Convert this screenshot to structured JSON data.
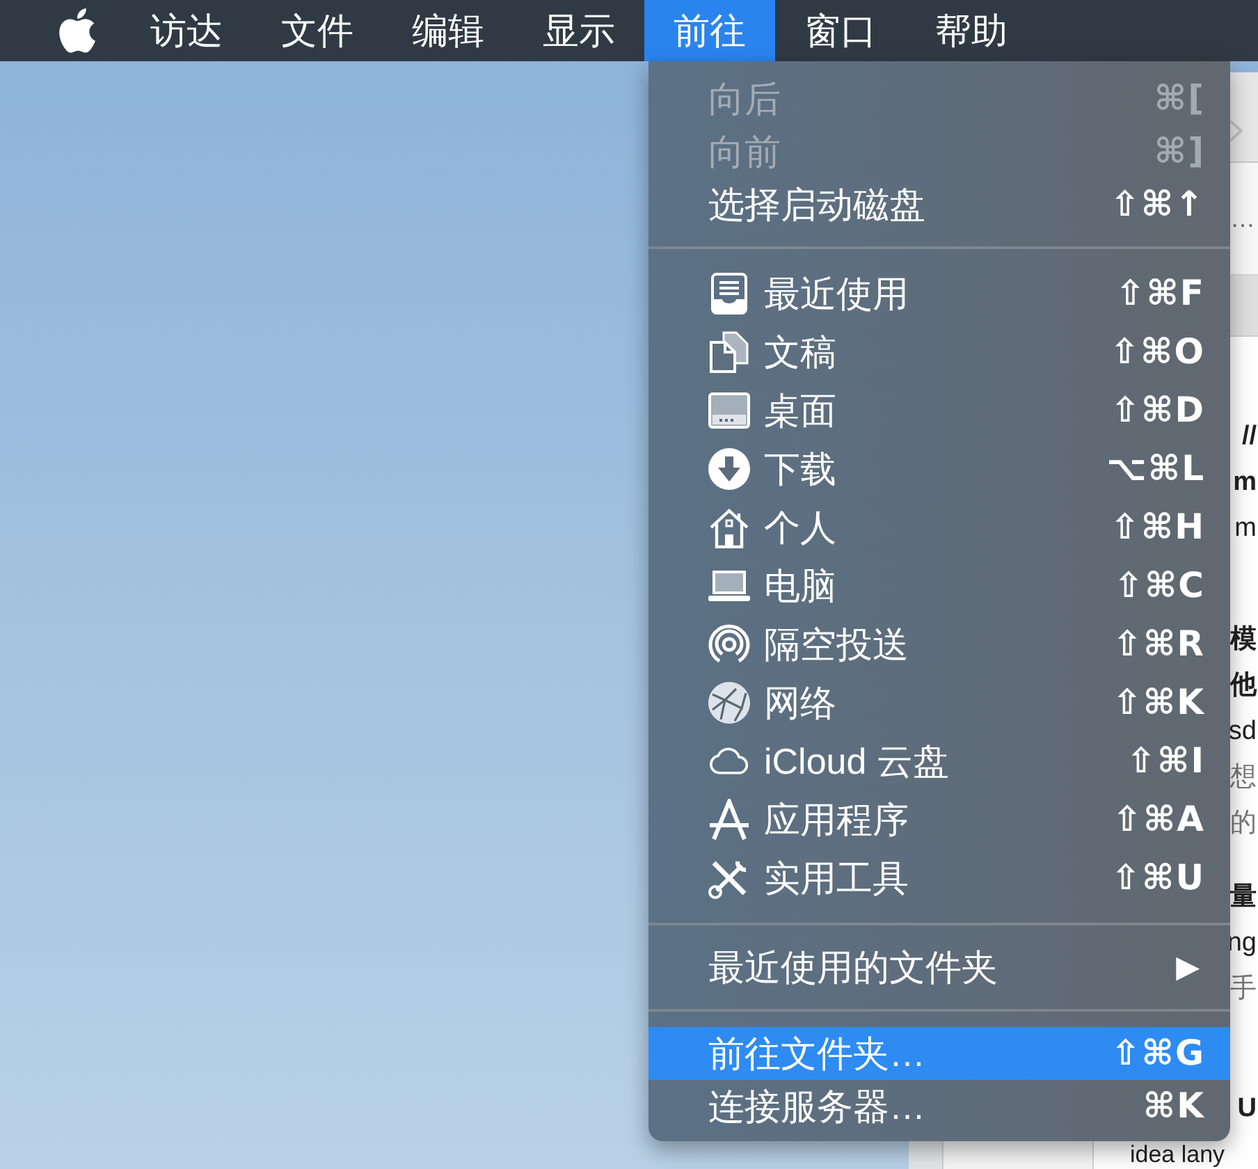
{
  "menu_bar": {
    "items": [
      {
        "label": "访达",
        "selected": false
      },
      {
        "label": "文件",
        "selected": false
      },
      {
        "label": "编辑",
        "selected": false
      },
      {
        "label": "显示",
        "selected": false
      },
      {
        "label": "前往",
        "selected": true
      },
      {
        "label": "窗口",
        "selected": false
      },
      {
        "label": "帮助",
        "selected": false
      }
    ]
  },
  "menu": {
    "groups": [
      {
        "items": [
          {
            "kind": "action",
            "label": "向后",
            "shortcut": "⌘[",
            "disabled": true,
            "selected": false
          },
          {
            "kind": "action",
            "label": "向前",
            "shortcut": "⌘]",
            "disabled": true,
            "selected": false
          },
          {
            "kind": "action",
            "label": "选择启动磁盘",
            "shortcut": "⇧⌘↑",
            "disabled": false,
            "selected": false
          }
        ]
      },
      {
        "items": [
          {
            "kind": "place",
            "label": "最近使用",
            "shortcut": "⇧⌘F",
            "disabled": false,
            "selected": false
          },
          {
            "kind": "place",
            "label": "文稿",
            "shortcut": "⇧⌘O",
            "disabled": false,
            "selected": false
          },
          {
            "kind": "place",
            "label": "桌面",
            "shortcut": "⇧⌘D",
            "disabled": false,
            "selected": false
          },
          {
            "kind": "place",
            "label": "下载",
            "shortcut": "⌥⌘L",
            "disabled": false,
            "selected": false
          },
          {
            "kind": "place",
            "label": "个人",
            "shortcut": "⇧⌘H",
            "disabled": false,
            "selected": false
          },
          {
            "kind": "place",
            "label": "电脑",
            "shortcut": "⇧⌘C",
            "disabled": false,
            "selected": false
          },
          {
            "kind": "place",
            "label": "隔空投送",
            "shortcut": "⇧⌘R",
            "disabled": false,
            "selected": false
          },
          {
            "kind": "place",
            "label": "网络",
            "shortcut": "⇧⌘K",
            "disabled": false,
            "selected": false
          },
          {
            "kind": "place",
            "label": "iCloud 云盘",
            "shortcut": "⇧⌘I",
            "disabled": false,
            "selected": false
          },
          {
            "kind": "place",
            "label": "应用程序",
            "shortcut": "⇧⌘A",
            "disabled": false,
            "selected": false
          },
          {
            "kind": "place",
            "label": "实用工具",
            "shortcut": "⇧⌘U",
            "disabled": false,
            "selected": false
          }
        ]
      },
      {
        "items": [
          {
            "kind": "submenu",
            "label": "最近使用的文件夹",
            "arrow": "▶",
            "disabled": false,
            "selected": false
          }
        ]
      },
      {
        "items": [
          {
            "kind": "action",
            "label": "前往文件夹…",
            "shortcut": "⇧⌘G",
            "disabled": false,
            "selected": true
          },
          {
            "kind": "action",
            "label": "连接服务器…",
            "shortcut": "⌘K",
            "disabled": false,
            "selected": false
          }
        ]
      }
    ]
  },
  "background_window": {
    "tab_title": "…",
    "paragraphs": [
      [
        {
          "kind": "bold",
          "text": "//"
        },
        {
          "kind": "bold",
          "text": "m"
        },
        {
          "kind": "plain",
          "text": "m"
        }
      ],
      [
        {
          "kind": "bold",
          "text": "模"
        },
        {
          "kind": "bold",
          "text": "他"
        },
        {
          "kind": "plain",
          "text": "sd"
        },
        {
          "kind": "gray",
          "text": "想"
        },
        {
          "kind": "gray",
          "text": "的"
        }
      ],
      [
        {
          "kind": "bold",
          "text": "量"
        },
        {
          "kind": "plain",
          "text": "ng"
        },
        {
          "kind": "gray",
          "text": "手"
        }
      ],
      [
        {
          "kind": "bold",
          "text": "U"
        }
      ]
    ],
    "bottom_text": "idea lany"
  }
}
